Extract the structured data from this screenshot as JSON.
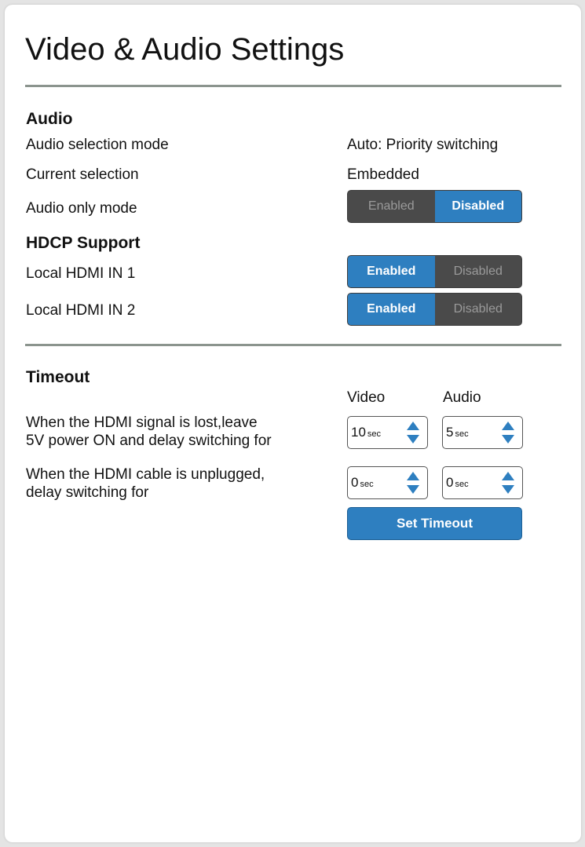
{
  "page": {
    "title": "Video & Audio Settings"
  },
  "audio": {
    "heading": "Audio",
    "selection_mode_label": "Audio selection mode",
    "selection_mode_value": "Auto: Priority switching",
    "current_selection_label": "Current selection",
    "current_selection_value": "Embedded",
    "audio_only_label": "Audio only mode",
    "audio_only_toggle": {
      "enabled_label": "Enabled",
      "disabled_label": "Disabled",
      "selected": "Disabled"
    }
  },
  "hdcp": {
    "heading": "HDCP Support",
    "inputs": [
      {
        "label": "Local HDMI IN 1",
        "enabled_label": "Enabled",
        "disabled_label": "Disabled",
        "selected": "Enabled"
      },
      {
        "label": "Local HDMI IN 2",
        "enabled_label": "Enabled",
        "disabled_label": "Disabled",
        "selected": "Enabled"
      }
    ]
  },
  "timeout": {
    "heading": "Timeout",
    "video_col": "Video",
    "audio_col": "Audio",
    "unit": "sec",
    "rows": [
      {
        "label_line1": "When the HDMI signal is lost,leave",
        "label_line2": "5V power ON and delay switching for",
        "video_value": "10",
        "audio_value": "5"
      },
      {
        "label_line1": "When the HDMI cable is unplugged,",
        "label_line2": "delay switching for",
        "video_value": "0",
        "audio_value": "0"
      }
    ],
    "set_button_label": "Set Timeout"
  },
  "colors": {
    "accent": "#2e7fc0",
    "toggle_off": "#4a4a4a",
    "divider": "#8b948e"
  }
}
